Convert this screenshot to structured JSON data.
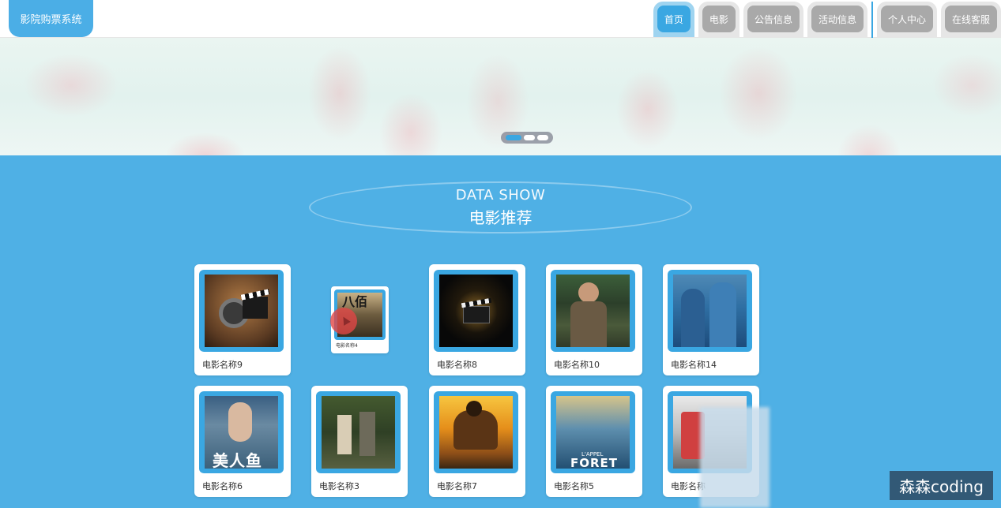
{
  "header": {
    "logo": "影院购票系统",
    "nav": [
      {
        "label": "首页",
        "active": true
      },
      {
        "label": "电影",
        "active": false
      },
      {
        "label": "公告信息",
        "active": false
      },
      {
        "label": "活动信息",
        "active": false
      },
      {
        "label": "个人中心",
        "active": false
      },
      {
        "label": "在线客服",
        "active": false
      }
    ]
  },
  "banner": {
    "slide_count": 3,
    "active_slide": 1
  },
  "section": {
    "title_en": "DATA SHOW",
    "title_cn": "电影推荐"
  },
  "movies": [
    {
      "name": "电影名称9"
    },
    {
      "name": "电影名称4"
    },
    {
      "name": "电影名称8"
    },
    {
      "name": "电影名称10"
    },
    {
      "name": "电影名称14"
    },
    {
      "name": "电影名称6"
    },
    {
      "name": "电影名称3"
    },
    {
      "name": "电影名称7"
    },
    {
      "name": "电影名称5"
    },
    {
      "name": "电影名称"
    }
  ],
  "poster_texts": {
    "mermaid": "美人鱼",
    "forest": "FORET",
    "forest_top": "L'APPEL",
    "small_top": "八佰"
  },
  "watermark": "森森coding",
  "colors": {
    "accent": "#3aa7e2",
    "background": "#4fb0e5",
    "nav_inactive": "#a9a9a9"
  }
}
